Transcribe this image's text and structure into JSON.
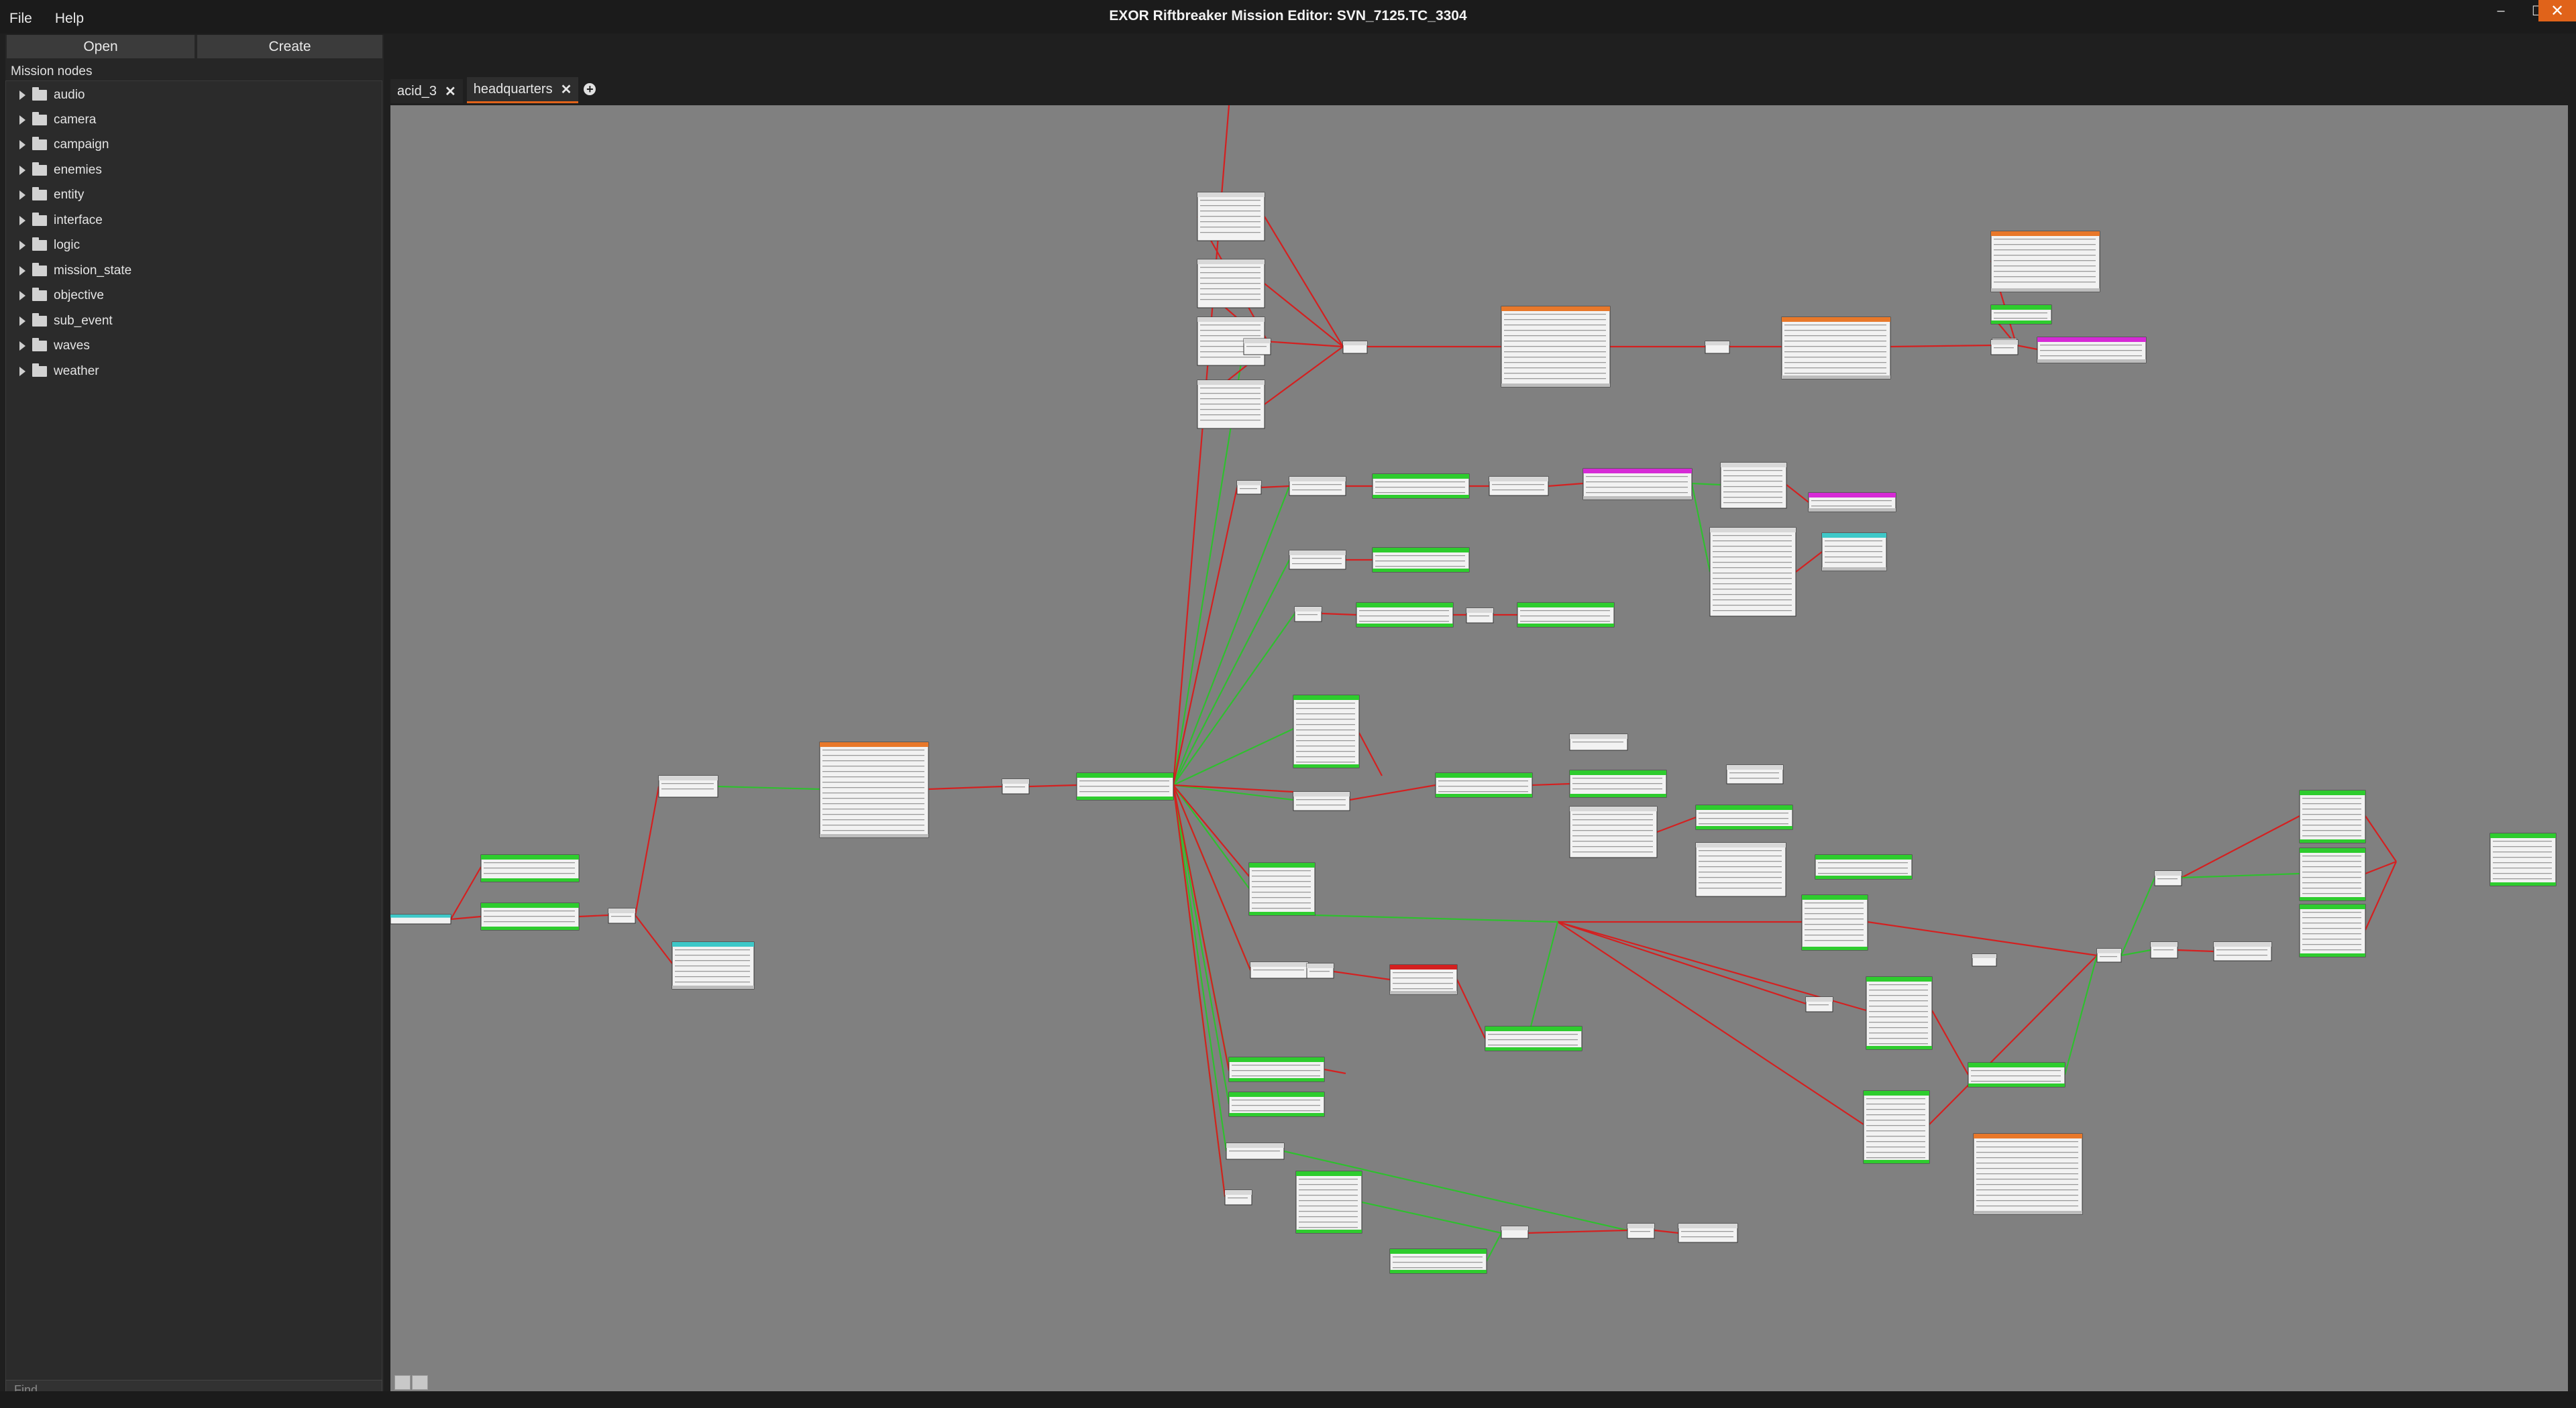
{
  "window": {
    "title": "EXOR Riftbreaker Mission Editor: SVN_7125.TC_3304",
    "minimize_glyph": "–",
    "maximize_glyph": "☐",
    "close_glyph": "✕",
    "close_color": "#e0631a"
  },
  "menu": [
    {
      "label": "File"
    },
    {
      "label": "Help"
    }
  ],
  "sidebar": {
    "open_label": "Open",
    "create_label": "Create",
    "title": "Mission nodes",
    "items": [
      {
        "label": "audio"
      },
      {
        "label": "camera"
      },
      {
        "label": "campaign"
      },
      {
        "label": "enemies"
      },
      {
        "label": "entity"
      },
      {
        "label": "interface"
      },
      {
        "label": "logic"
      },
      {
        "label": "mission_state"
      },
      {
        "label": "objective"
      },
      {
        "label": "sub_event"
      },
      {
        "label": "waves"
      },
      {
        "label": "weather"
      }
    ],
    "find_placeholder": "Find..."
  },
  "tabs": [
    {
      "label": "acid_3",
      "active": false
    },
    {
      "label": "headquarters",
      "active": true
    }
  ],
  "graph": {
    "background": "#808080",
    "link_red": "#d42020",
    "link_green": "#2fbf2f",
    "header_colors": {
      "green": "#2ecc2e",
      "orange": "#e8782a",
      "magenta": "#d62ad6",
      "teal": "#3ec8c8",
      "gray": "#d8d8d8"
    }
  }
}
